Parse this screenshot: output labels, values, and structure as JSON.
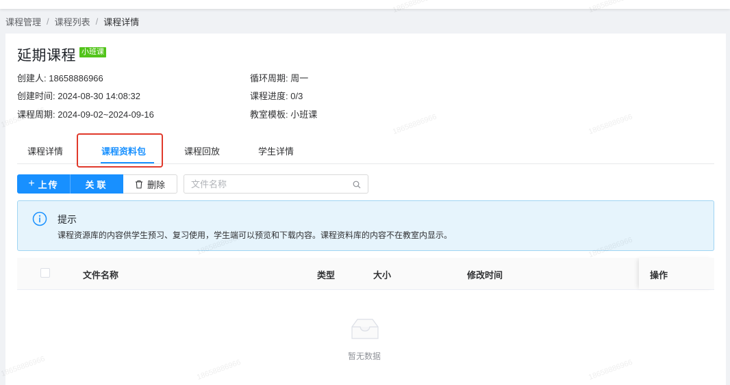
{
  "breadcrumb": {
    "items": [
      "课程管理",
      "课程列表"
    ],
    "current": "课程详情",
    "separator": "/"
  },
  "course": {
    "title": "延期课程",
    "tag": "小班课",
    "info": {
      "creator": "创建人: 18658886966",
      "created_time": "创建时间: 2024-08-30 14:08:32",
      "period": "课程周期: 2024-09-02~2024-09-16",
      "cycle": "循环周期: 周一",
      "progress": "课程进度: 0/3",
      "template": "教室模板: 小班课"
    }
  },
  "tabs": [
    {
      "label": "课程详情",
      "active": false
    },
    {
      "label": "课程资料包",
      "active": true
    },
    {
      "label": "课程回放",
      "active": false
    },
    {
      "label": "学生详情",
      "active": false
    }
  ],
  "toolbar": {
    "upload_label": "上传",
    "link_label": "关联",
    "delete_label": "删除"
  },
  "search": {
    "placeholder": "文件名称",
    "value": ""
  },
  "alert": {
    "title": "提示",
    "description": "课程资源库的内容供学生预习、复习使用，学生端可以预览和下载内容。课程资料库的内容不在教室内显示。"
  },
  "table": {
    "columns": [
      "文件名称",
      "类型",
      "大小",
      "修改时间",
      "操作"
    ],
    "rows": [],
    "empty_text": "暂无数据"
  },
  "watermark": {
    "text": "18658886966"
  },
  "colors": {
    "primary": "#1890ff",
    "tag_green": "#52c41a",
    "highlight_red": "#e0382a",
    "alert_bg": "#e6f4fc",
    "alert_border": "#9fd4f3"
  },
  "icons": {
    "upload": "plus-icon",
    "delete": "trash-icon",
    "search": "search-icon",
    "alert": "info-circle-icon",
    "empty": "empty-inbox-icon"
  }
}
